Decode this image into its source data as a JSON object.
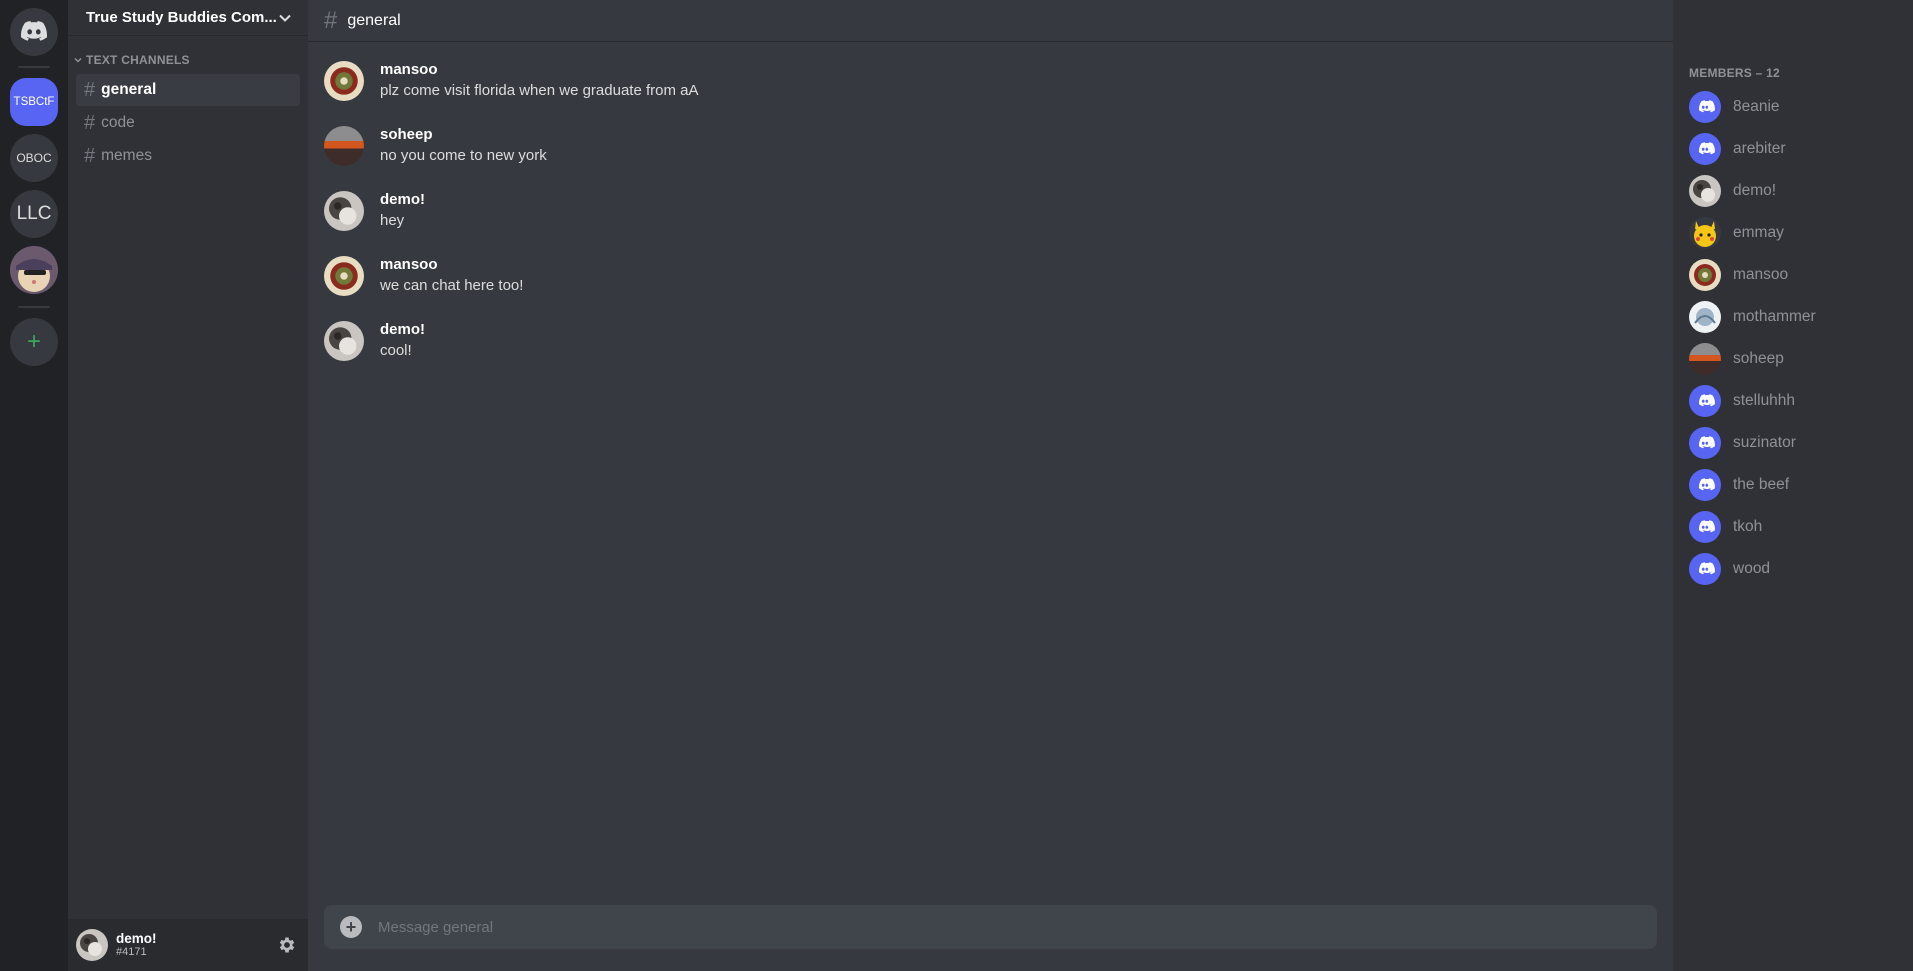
{
  "servers": [
    {
      "id": "home",
      "label": "",
      "icon": "discord-icon"
    },
    {
      "id": "tsbctf",
      "label": "TSBCtF",
      "active": true
    },
    {
      "id": "oboc",
      "label": "OBOC"
    },
    {
      "id": "llc",
      "label": "LLC"
    },
    {
      "id": "cat",
      "label": "",
      "icon": "cat-avatar-icon"
    },
    {
      "id": "add",
      "label": "+",
      "icon": "add-server-icon"
    }
  ],
  "guild": {
    "name": "True Study Buddies Com...",
    "category": "TEXT CHANNELS",
    "channels": [
      {
        "name": "general",
        "active": true
      },
      {
        "name": "code"
      },
      {
        "name": "memes"
      }
    ]
  },
  "current_user": {
    "name": "demo!",
    "tag": "#4171"
  },
  "chat": {
    "channel": "general",
    "messages": [
      {
        "author": "mansoo",
        "text": "plz come visit florida when we graduate from aA",
        "avatar": "ornament"
      },
      {
        "author": "soheep",
        "text": "no you come to new york",
        "avatar": "sunset"
      },
      {
        "author": "demo!",
        "text": "hey",
        "avatar": "photo"
      },
      {
        "author": "mansoo",
        "text": "we can chat here too!",
        "avatar": "ornament"
      },
      {
        "author": "demo!",
        "text": "cool!",
        "avatar": "photo"
      }
    ],
    "composer_placeholder": "Message general"
  },
  "members": {
    "title": "MEMBERS – 12",
    "list": [
      {
        "name": "8eanie",
        "avatar": "discord"
      },
      {
        "name": "arebiter",
        "avatar": "discord"
      },
      {
        "name": "demo!",
        "avatar": "photo"
      },
      {
        "name": "emmay",
        "avatar": "pikachu"
      },
      {
        "name": "mansoo",
        "avatar": "ornament"
      },
      {
        "name": "mothammer",
        "avatar": "sketch"
      },
      {
        "name": "soheep",
        "avatar": "sunset"
      },
      {
        "name": "stelluhhh",
        "avatar": "discord"
      },
      {
        "name": "suzinator",
        "avatar": "discord"
      },
      {
        "name": "the beef",
        "avatar": "discord"
      },
      {
        "name": "tkoh",
        "avatar": "discord"
      },
      {
        "name": "wood",
        "avatar": "discord"
      }
    ]
  },
  "colors": {
    "accent": "#5865f2",
    "rail": "#202225",
    "sidebar": "#2f3136",
    "chat": "#36393f",
    "add_green": "#3ba55d"
  }
}
